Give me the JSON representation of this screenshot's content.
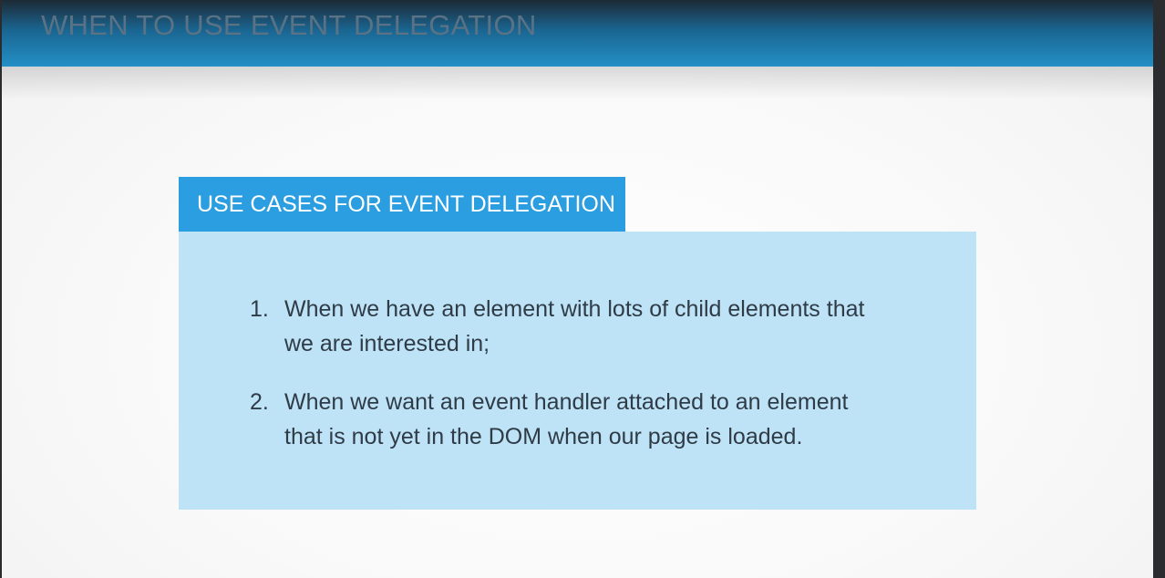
{
  "header": {
    "title": "WHEN TO USE EVENT DELEGATION"
  },
  "box": {
    "title": "USE CASES FOR EVENT DELEGATION",
    "items": [
      {
        "number": "1.",
        "lines": [
          "When we have an element with lots of child elements that",
          "we are interested in;"
        ]
      },
      {
        "number": "2.",
        "lines": [
          "When we want an event handler attached to an element",
          "that is not yet in the DOM when our page is loaded."
        ]
      }
    ]
  }
}
